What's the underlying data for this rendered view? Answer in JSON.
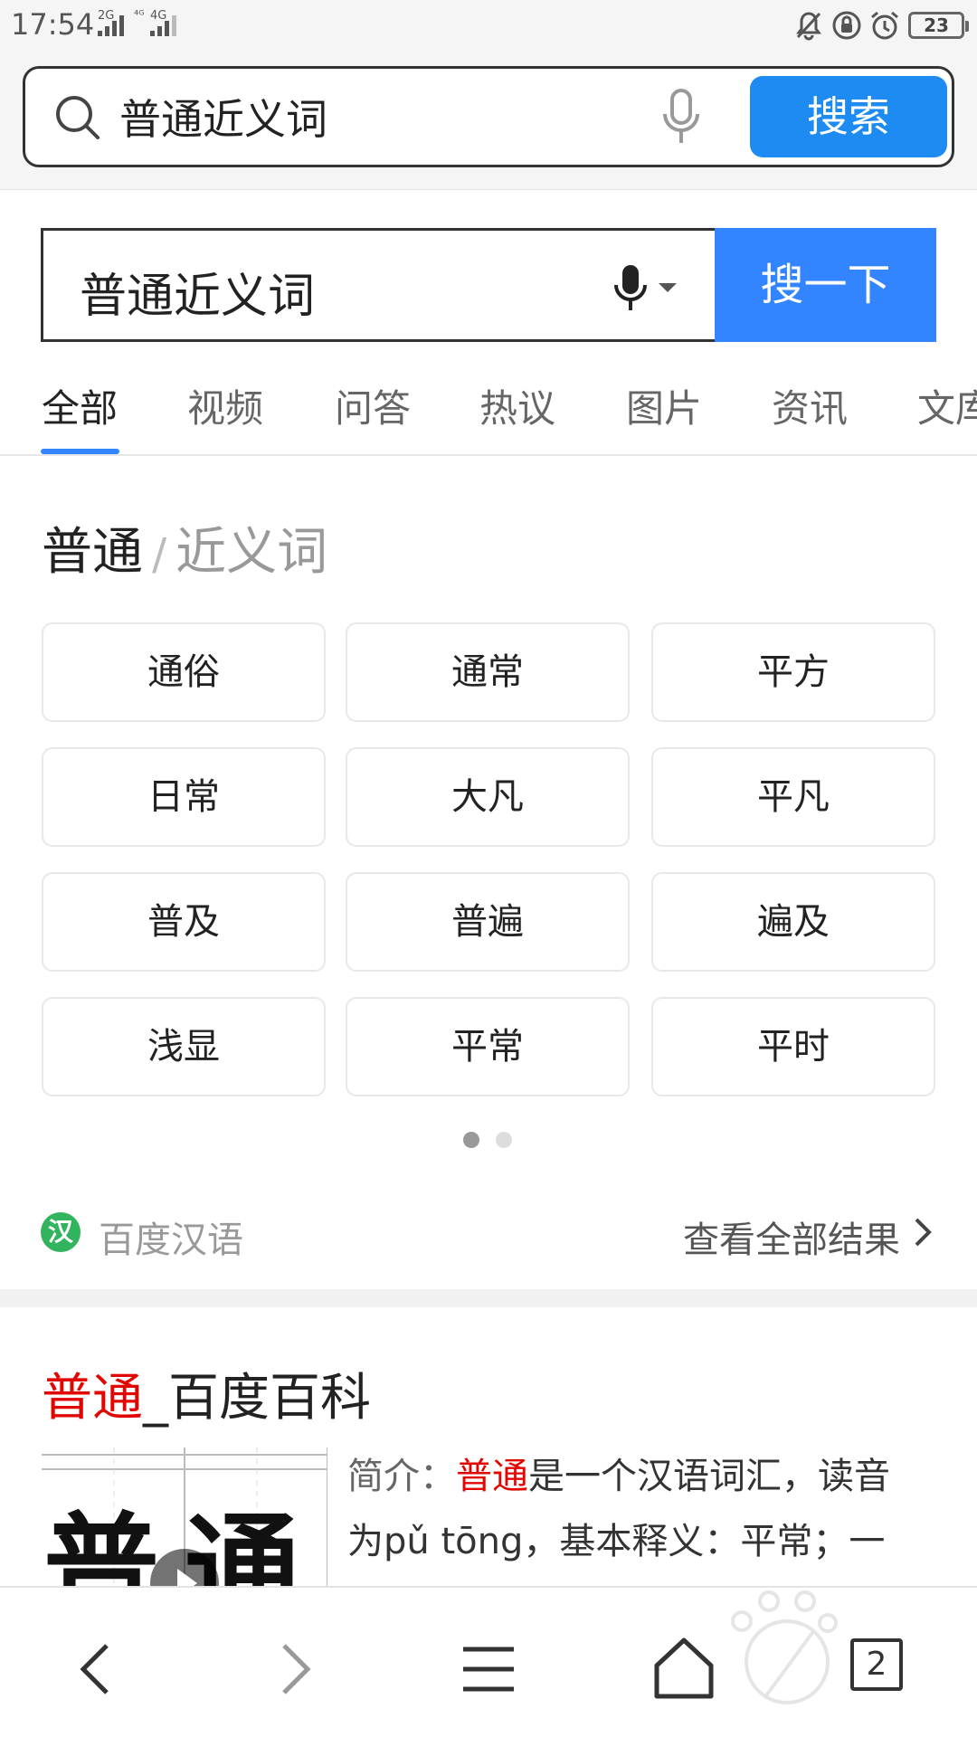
{
  "status_bar": {
    "time": "17:54",
    "net1": "2G",
    "net2": "4G",
    "battery": "23"
  },
  "browser": {
    "query": "普通近义词",
    "search_label": "搜索"
  },
  "page_search": {
    "query": "普通近义词",
    "button_label": "搜一下"
  },
  "tabs": [
    "全部",
    "视频",
    "问答",
    "热议",
    "图片",
    "资讯",
    "文库"
  ],
  "synonyms": {
    "word": "普通",
    "separator": "/",
    "kind": "近义词",
    "items": [
      "通俗",
      "通常",
      "平方",
      "日常",
      "大凡",
      "平凡",
      "普及",
      "普遍",
      "遍及",
      "浅显",
      "平常",
      "平时"
    ],
    "source_badge": "汉",
    "source": "百度汉语",
    "more_label": "查看全部结果"
  },
  "baike": {
    "title_highlight": "普通",
    "title_rest": "_百度百科",
    "intro_label": "简介：",
    "intro_highlight": "普通",
    "intro_text_1": "是一个汉语词汇，读音",
    "intro_text_2": "为pǔ tōng，基本释义：平常；一",
    "thumb_chars": "普通"
  },
  "bottom_nav": {
    "tab_count": "2"
  },
  "colors": {
    "accent_blue": "#3385ff",
    "browser_blue": "#1e8bf3",
    "highlight_red": "#e10601",
    "hanyu_green": "#31b45d"
  }
}
